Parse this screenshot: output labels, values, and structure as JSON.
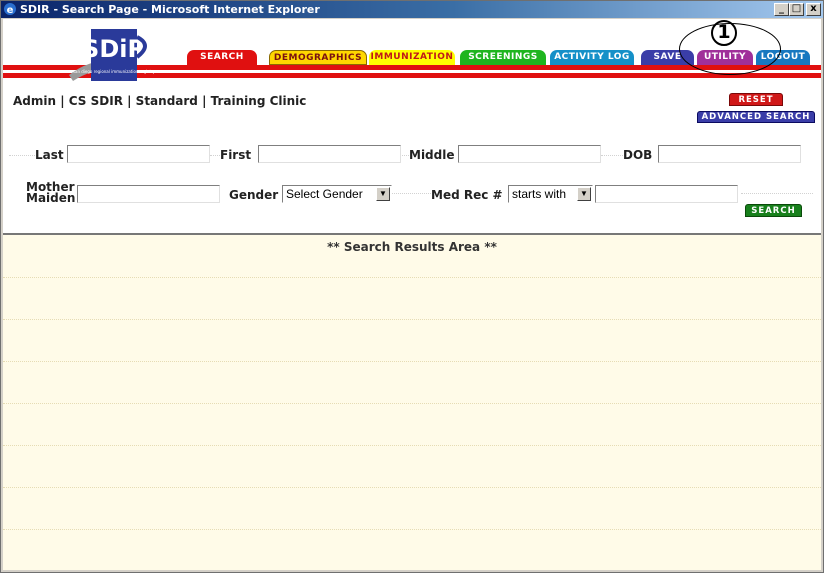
{
  "window": {
    "title": "SDIR - Search Page - Microsoft Internet Explorer",
    "buttons": {
      "minimize": "_",
      "maximize": "□",
      "close": "x"
    }
  },
  "logo": {
    "text": "SDiR",
    "sub": "san diego regional immunization registry"
  },
  "nav": {
    "tabs": [
      {
        "label": "SEARCH",
        "color": "#e01010"
      },
      {
        "label": "DEMOGRAPHICS",
        "color": "#ffd700"
      },
      {
        "label": "IMMUNIZATION",
        "color": "#ffff00"
      },
      {
        "label": "SCREENINGS",
        "color": "#1fb51f"
      },
      {
        "label": "ACTIVITY LOG",
        "color": "#1590c8"
      },
      {
        "label": "SAVE",
        "color": "#3a3da8"
      },
      {
        "label": "UTILITY",
        "color": "#a0309a"
      },
      {
        "label": "LOGOUT",
        "color": "#1878c0"
      }
    ]
  },
  "callout": {
    "number": "1"
  },
  "context": {
    "text": "Admin | CS SDIR | Standard | Training Clinic"
  },
  "buttons": {
    "reset": "RESET",
    "advanced_search": "ADVANCED SEARCH",
    "search": "SEARCH"
  },
  "form": {
    "last": {
      "label": "Last",
      "value": ""
    },
    "first": {
      "label": "First",
      "value": ""
    },
    "middle": {
      "label": "Middle",
      "value": ""
    },
    "dob": {
      "label": "DOB",
      "value": ""
    },
    "mother_maiden": {
      "label_line1": "Mother",
      "label_line2": "Maiden",
      "value": ""
    },
    "gender": {
      "label": "Gender",
      "selected": "Select Gender"
    },
    "med_rec": {
      "label": "Med Rec #",
      "match_selected": "starts with",
      "value": ""
    }
  },
  "results": {
    "title": "** Search Results Area **"
  }
}
